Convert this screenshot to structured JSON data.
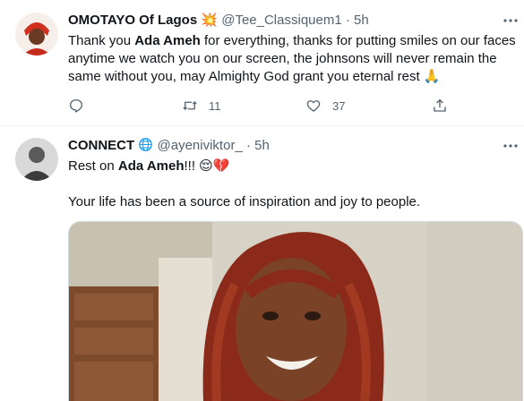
{
  "tweets": [
    {
      "display_name": "OMOTAYO Of Lagos",
      "name_emoji": "💥",
      "handle": "@Tee_Classiquem1",
      "separator": "·",
      "time": "5h",
      "text": {
        "p1": "Thank you ",
        "p1_bold": "Ada Ameh",
        "p2": " for everything, thanks for putting smiles on our faces anytime we watch you on our screen, the johnsons will never remain the same without you, may Almighty God grant you eternal rest ",
        "emoji": "🙏"
      },
      "actions": {
        "reply_icon": "reply-icon",
        "retweet_icon": "retweet-icon",
        "retweet_count": "11",
        "like_icon": "heart-icon",
        "like_count": "37",
        "share_icon": "share-icon"
      }
    },
    {
      "display_name": "CONNECT",
      "name_icon": "globe-icon",
      "handle": "@ayeniviktor_",
      "separator": "·",
      "time": "5h",
      "line1": {
        "prefix": "Rest on ",
        "bold": "Ada Ameh",
        "suffix": "!!! ",
        "emojis": "😌💔"
      },
      "line2": "Your life has been a source of inspiration and joy to people."
    }
  ],
  "colors": {
    "text": "#0f1419",
    "secondary": "#536471",
    "divider": "#eff3f4",
    "globe": "#1d9bf0"
  }
}
